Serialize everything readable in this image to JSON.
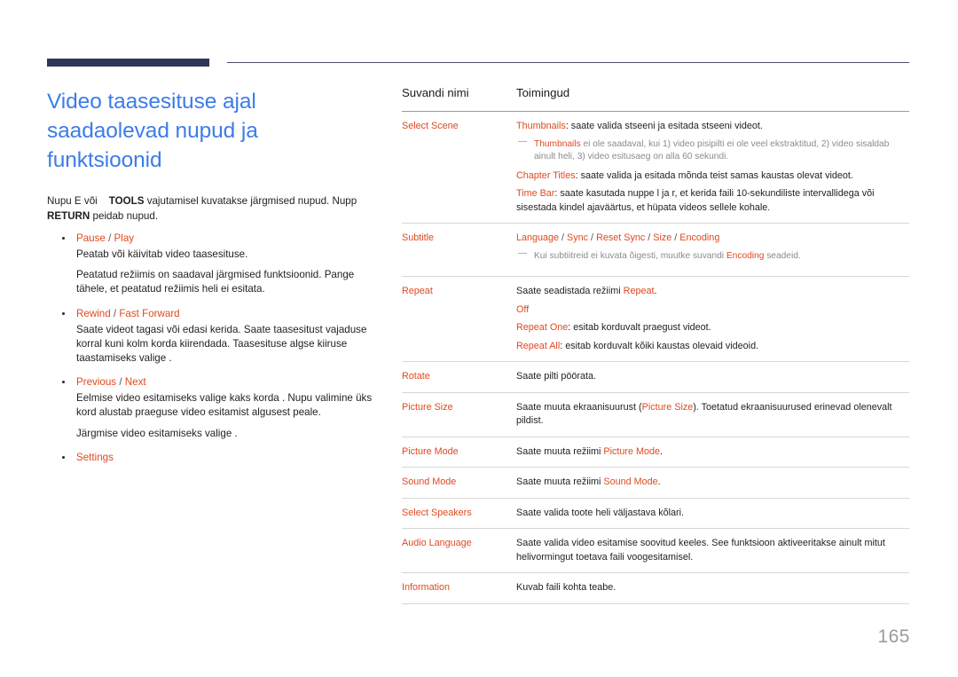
{
  "colors": {
    "accent_orange": "#e0491f",
    "title_blue": "#3c7ce8",
    "rule_navy": "#2f3757",
    "page_number_gray": "#9a9a9a",
    "note_gray": "#8b8b8b"
  },
  "header": {
    "rule_label": "top-rule"
  },
  "left": {
    "title": "Video taasesituse ajal saadaolevad nupud ja funktsioonid",
    "intro_part1": "Nupu E või",
    "intro_tools": "TOOLS",
    "intro_part2": "vajutamisel kuvatakse järgmised nupud. Nupp",
    "intro_return": "RETURN",
    "intro_part3": "peidab nupud.",
    "bullets": [
      {
        "head_a": "Pause",
        "head_sep": " / ",
        "head_b": "Play",
        "paras": [
          "Peatab või käivitab video taasesituse.",
          "Peatatud režiimis on saadaval järgmised funktsioonid. Pange tähele, et peatatud režiimis heli ei esitata."
        ]
      },
      {
        "head_a": "Rewind",
        "head_sep": " / ",
        "head_b": "Fast Forward",
        "paras": [
          "Saate videot tagasi või edasi kerida. Saate taasesitust vajaduse korral kuni kolm korda kiirendada. Taasesituse algse kiiruse taastamiseks valige ."
        ]
      },
      {
        "head_a": "Previous",
        "head_sep": " / ",
        "head_b": "Next",
        "paras": [
          "Eelmise video esitamiseks valige kaks korda . Nupu valimine üks kord alustab praeguse video esitamist algusest peale.",
          "Järgmise video esitamiseks valige ."
        ]
      },
      {
        "head_a": "Settings",
        "head_sep": "",
        "head_b": "",
        "paras": []
      }
    ]
  },
  "table": {
    "headers": {
      "col1": "Suvandi nimi",
      "col2": "Toimingud"
    },
    "rows": [
      {
        "option": "Select Scene",
        "lines": [
          {
            "type": "para",
            "k1": "Thumbnails",
            "text": ": saate valida stseeni ja esitada stseeni videot."
          },
          {
            "type": "note",
            "k1": "Thumbnails",
            "text": " ei ole saadaval, kui 1) video pisipilti ei ole veel ekstraktitud, 2) video sisaldab ainult heli, 3) video esitusaeg on alla 60 sekundi."
          },
          {
            "type": "para",
            "k1": "Chapter Titles",
            "text": ": saate valida ja esitada mõnda teist samas kaustas olevat videot."
          },
          {
            "type": "para",
            "k1": "Time Bar",
            "text": ": saate kasutada nuppe l ja  r, et kerida faili 10-sekundiliste intervallidega või sisestada kindel ajaväärtus, et hüpata videos sellele kohale."
          }
        ]
      },
      {
        "option": "Subtitle",
        "lines": [
          {
            "type": "keys",
            "keys": [
              "Language",
              "Sync",
              "Reset Sync",
              "Size",
              "Encoding"
            ]
          },
          {
            "type": "note_mid",
            "pre": "Kui subtiitreid ei kuvata õigesti, muutke suvandi ",
            "k1": "Encoding",
            "post": " seadeid."
          }
        ]
      },
      {
        "option": "Repeat",
        "lines": [
          {
            "type": "para_pre",
            "pre": "Saate seadistada režiimi ",
            "k1": "Repeat",
            "text": "."
          },
          {
            "type": "para",
            "k1": "Off",
            "text": ""
          },
          {
            "type": "para",
            "k1": "Repeat One",
            "text": ": esitab korduvalt praegust videot."
          },
          {
            "type": "para",
            "k1": "Repeat All",
            "text": ": esitab korduvalt kõiki kaustas olevaid videoid."
          }
        ]
      },
      {
        "option": "Rotate",
        "lines": [
          {
            "type": "plain",
            "text": "Saate pilti pöörata."
          }
        ]
      },
      {
        "option": "Picture Size",
        "lines": [
          {
            "type": "para_pre",
            "pre": "Saate muuta ekraanisuurust (",
            "k1": "Picture Size",
            "text": "). Toetatud ekraanisuurused erinevad olenevalt pildist."
          }
        ]
      },
      {
        "option": "Picture Mode",
        "lines": [
          {
            "type": "para_pre",
            "pre": "Saate muuta režiimi ",
            "k1": "Picture Mode",
            "text": "."
          }
        ]
      },
      {
        "option": "Sound Mode",
        "lines": [
          {
            "type": "para_pre",
            "pre": "Saate muuta režiimi ",
            "k1": "Sound Mode",
            "text": "."
          }
        ]
      },
      {
        "option": "Select Speakers",
        "lines": [
          {
            "type": "plain",
            "text": "Saate valida toote heli väljastava kõlari."
          }
        ]
      },
      {
        "option": "Audio Language",
        "lines": [
          {
            "type": "plain",
            "text": "Saate valida video esitamise soovitud keeles. See funktsioon aktiveeritakse ainult mitut helivormingut toetava faili voogesitamisel."
          }
        ]
      },
      {
        "option": "Information",
        "lines": [
          {
            "type": "plain",
            "text": "Kuvab faili kohta teabe."
          }
        ]
      }
    ]
  },
  "footer": {
    "page_number": "165"
  }
}
